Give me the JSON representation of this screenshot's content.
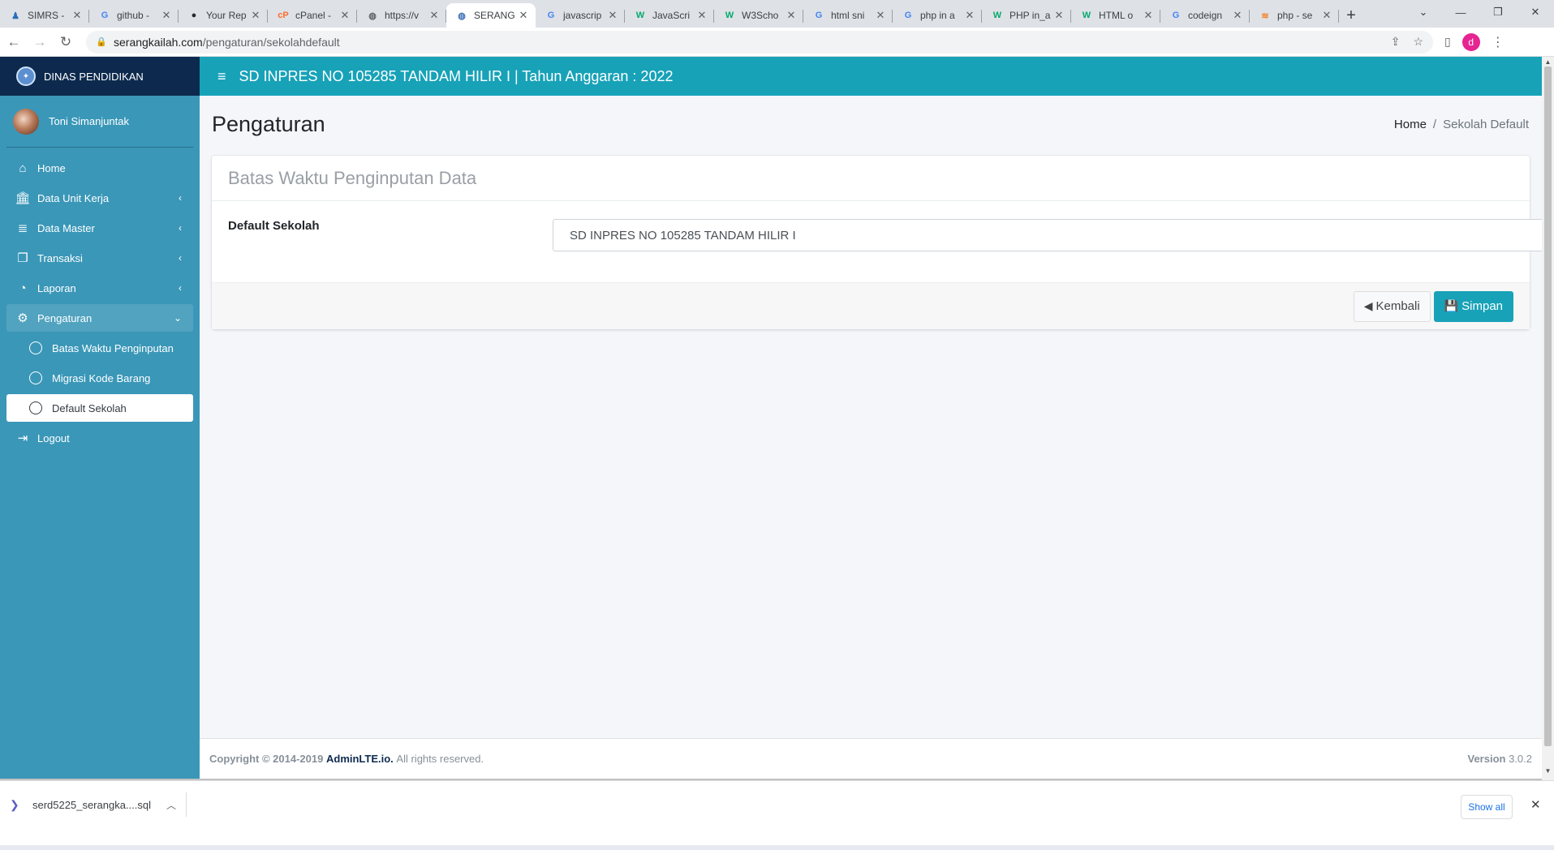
{
  "browser": {
    "tabs": [
      {
        "title": "SIMRS -",
        "icon": "person-icon",
        "color": "#2a6fbb",
        "active": false
      },
      {
        "title": "github -",
        "icon": "google-icon",
        "color": "#4285f4",
        "active": false
      },
      {
        "title": "Your Rep",
        "icon": "github-icon",
        "color": "#24292e",
        "active": false
      },
      {
        "title": "cPanel -",
        "icon": "cpanel-icon",
        "color": "#ff6c2c",
        "active": false
      },
      {
        "title": "https://v",
        "icon": "globe-icon",
        "color": "#5f6368",
        "active": false
      },
      {
        "title": "SERANG",
        "icon": "globe-icon",
        "color": "#3b6fb6",
        "active": true
      },
      {
        "title": "javascrip",
        "icon": "google-icon",
        "color": "#4285f4",
        "active": false
      },
      {
        "title": "JavaScri",
        "icon": "w3schools-icon",
        "color": "#04aa6d",
        "active": false
      },
      {
        "title": "W3Scho",
        "icon": "w3schools-icon",
        "color": "#04aa6d",
        "active": false
      },
      {
        "title": "html sni",
        "icon": "google-icon",
        "color": "#4285f4",
        "active": false
      },
      {
        "title": "php in a",
        "icon": "google-icon",
        "color": "#4285f4",
        "active": false
      },
      {
        "title": "PHP in_a",
        "icon": "w3schools-icon",
        "color": "#04aa6d",
        "active": false
      },
      {
        "title": "HTML o",
        "icon": "w3schools-icon",
        "color": "#04aa6d",
        "active": false
      },
      {
        "title": "codeign",
        "icon": "google-icon",
        "color": "#4285f4",
        "active": false
      },
      {
        "title": "php - se",
        "icon": "stackoverflow-icon",
        "color": "#f48024",
        "active": false
      }
    ],
    "url_host": "serangkailah.com",
    "url_path": "/pengaturan/sekolahdefault",
    "profile_initial": "d"
  },
  "sidebar": {
    "brand": "DINAS PENDIDIKAN",
    "user": "Toni Simanjuntak",
    "items": [
      {
        "label": "Home",
        "icon": "home-icon",
        "glyph": "⌂",
        "chevron": false
      },
      {
        "label": "Data Unit Kerja",
        "icon": "institution-icon",
        "glyph": "🏛",
        "chevron": true
      },
      {
        "label": "Data Master",
        "icon": "database-icon",
        "glyph": "≣",
        "chevron": true
      },
      {
        "label": "Transaksi",
        "icon": "copy-icon",
        "glyph": "❐",
        "chevron": true
      },
      {
        "label": "Laporan",
        "icon": "pie-chart-icon",
        "glyph": "◔",
        "chevron": true
      },
      {
        "label": "Pengaturan",
        "icon": "gears-icon",
        "glyph": "⚙",
        "chevron": true
      }
    ],
    "submenu": [
      {
        "label": "Batas Waktu Penginputan"
      },
      {
        "label": "Migrasi Kode Barang"
      },
      {
        "label": "Default Sekolah"
      }
    ],
    "logout": "Logout"
  },
  "topbar": {
    "title": "SD INPRES NO 105285 TANDAM HILIR I | Tahun Anggaran : 2022"
  },
  "page": {
    "title": "Pengaturan",
    "breadcrumb_home": "Home",
    "breadcrumb_current": "Sekolah Default"
  },
  "card": {
    "title": "Batas Waktu Penginputan Data",
    "field_label": "Default Sekolah",
    "field_value": "SD INPRES NO 105285 TANDAM HILIR I",
    "back_label": "Kembali",
    "save_label": "Simpan"
  },
  "footer": {
    "copyright": "Copyright © 2014-2019",
    "link": "AdminLTE.io.",
    "rights": "All rights reserved.",
    "version_label": "Version",
    "version": "3.0.2"
  },
  "downloads": {
    "file": "serd5225_serangka....sql",
    "show_all": "Show all"
  },
  "colors": {
    "brand_bg": "#0d2a4e",
    "sidebar_bg": "#3a97b8",
    "topbar_bg": "#17a2b8",
    "primary_button": "#17a2b8"
  }
}
